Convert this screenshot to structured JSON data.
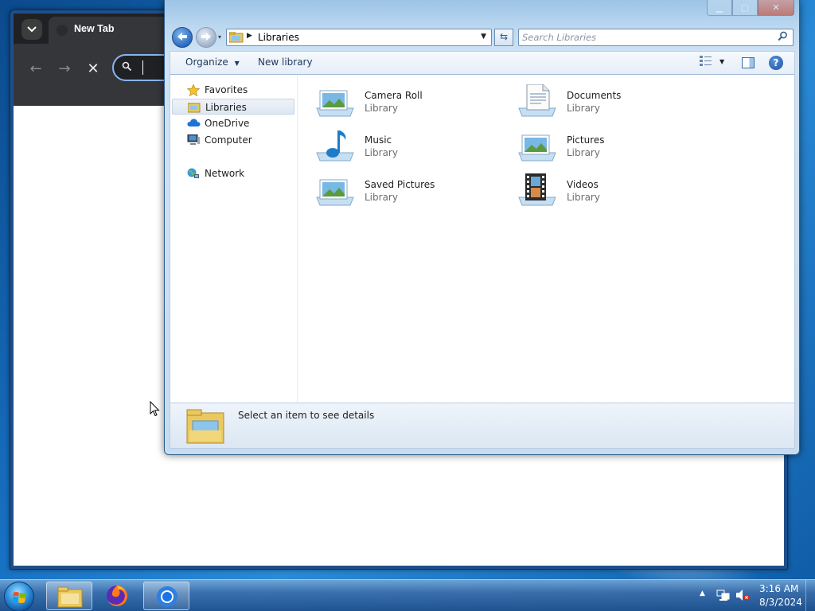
{
  "browser": {
    "tab_title": "New Tab",
    "icons": [
      "chevron-down-icon",
      "back-arrow-icon",
      "forward-arrow-icon",
      "close-icon",
      "search-icon"
    ]
  },
  "explorer": {
    "address": {
      "breadcrumb": "Libraries"
    },
    "search": {
      "placeholder": "Search Libraries"
    },
    "toolbar": {
      "organize_label": "Organize",
      "new_library_label": "New library"
    },
    "nav": {
      "items": [
        {
          "label": "Favorites",
          "icon": "star-icon"
        },
        {
          "label": "Libraries",
          "icon": "libraries-icon",
          "selected": true
        },
        {
          "label": "OneDrive",
          "icon": "cloud-icon"
        },
        {
          "label": "Computer",
          "icon": "computer-icon"
        },
        {
          "label": "Network",
          "icon": "network-icon"
        }
      ]
    },
    "libraries": [
      {
        "name": "Camera Roll",
        "type": "Library"
      },
      {
        "name": "Documents",
        "type": "Library"
      },
      {
        "name": "Music",
        "type": "Library"
      },
      {
        "name": "Pictures",
        "type": "Library"
      },
      {
        "name": "Saved Pictures",
        "type": "Library"
      },
      {
        "name": "Videos",
        "type": "Library"
      }
    ],
    "details": {
      "text": "Select an item to see details"
    },
    "colors": {
      "accent": "#2a6ac0",
      "selection": "#dde7f2"
    }
  },
  "taskbar": {
    "clock": {
      "time": "3:16 AM",
      "date": "8/3/2024"
    },
    "apps": [
      "windows-explorer",
      "firefox",
      "chrome"
    ]
  }
}
